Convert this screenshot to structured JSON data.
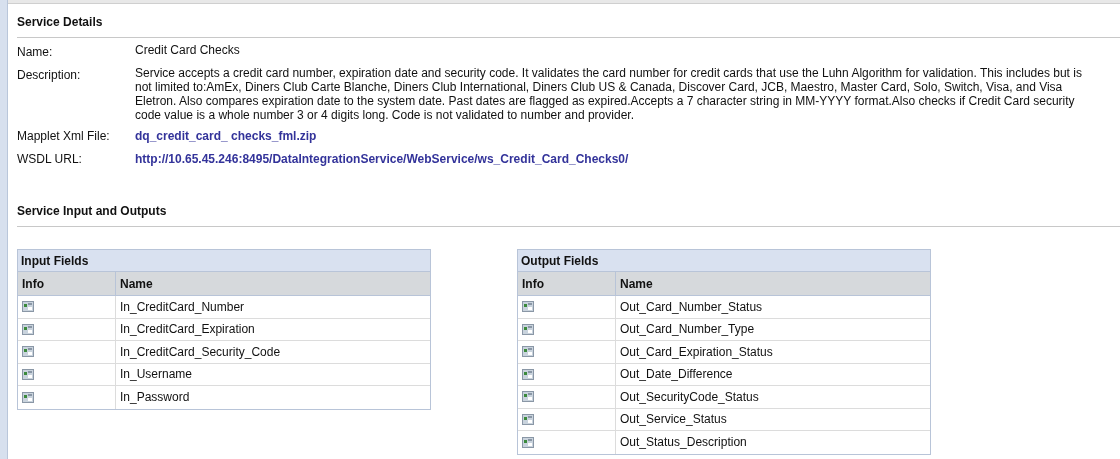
{
  "service_details": {
    "title": "Service Details",
    "fields": [
      {
        "label": "Name:",
        "value": "Credit Card Checks",
        "kind": "text"
      },
      {
        "label": "Description:",
        "value": "Service accepts a credit card number, expiration date and security code. It validates the card number for credit cards that use the Luhn Algorithm for validation. This includes but is not limited to:AmEx, Diners Club Carte Blanche, Diners Club International, Diners Club US & Canada, Discover Card, JCB, Maestro, Master Card, Solo, Switch, Visa, and Visa Eletron. Also compares expiration date to the system date. Past dates are flagged as expired.Accepts a 7 character string in MM-YYYY format.Also checks if Credit Card security code value is a whole number 3 or 4 digits long. Code is not validated to number and provider.",
        "kind": "text"
      },
      {
        "label": "Mapplet Xml File:",
        "value": "dq_credit_card_ checks_fml.zip",
        "kind": "link"
      },
      {
        "label": "WSDL URL:",
        "value": "http://10.65.45.246:8495/DataIntegrationService/WebService/ws_Credit_Card_Checks0/",
        "kind": "link"
      }
    ]
  },
  "io": {
    "title": "Service Input and Outputs",
    "tables": [
      {
        "title": "Input Fields",
        "columns": [
          "Info",
          "Name"
        ],
        "rows": [
          "In_CreditCard_Number",
          "In_CreditCard_Expiration",
          "In_CreditCard_Security_Code",
          "In_Username",
          "In_Password"
        ]
      },
      {
        "title": "Output Fields",
        "columns": [
          "Info",
          "Name"
        ],
        "rows": [
          "Out_Card_Number_Status",
          "Out_Card_Number_Type",
          "Out_Card_Expiration_Status",
          "Out_Date_Difference",
          "Out_SecurityCode_Status",
          "Out_Service_Status",
          "Out_Status_Description"
        ]
      }
    ]
  }
}
